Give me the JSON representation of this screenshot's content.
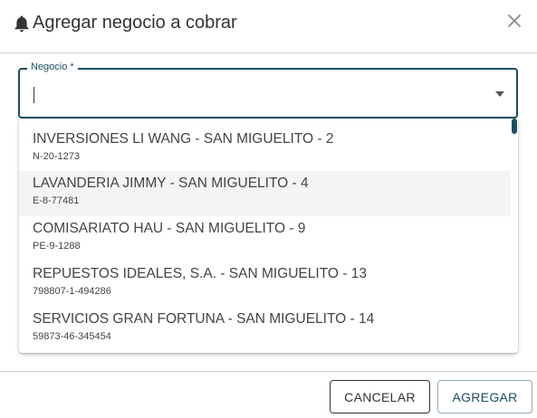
{
  "dialog": {
    "title": "Agregar negocio a cobrar",
    "icon": "bell-icon",
    "close_icon": "close-icon"
  },
  "field": {
    "label": "Negocio *",
    "value": "",
    "dropdown_icon": "caret-down-icon"
  },
  "options": [
    {
      "name": "INVERSIONES LI WANG - SAN MIGUELITO - 2",
      "code": "N-20-1273"
    },
    {
      "name": "LAVANDERIA JIMMY - SAN MIGUELITO - 4",
      "code": "E-8-77481"
    },
    {
      "name": "COMISARIATO HAU - SAN MIGUELITO - 9",
      "code": "PE-9-1288"
    },
    {
      "name": "REPUESTOS IDEALES, S.A. - SAN MIGUELITO - 13",
      "code": "798807-1-494286"
    },
    {
      "name": "SERVICIOS GRAN FORTUNA - SAN MIGUELITO - 14",
      "code": "59873-46-345454"
    }
  ],
  "footer": {
    "cancel_label": "CANCELAR",
    "add_label": "AGREGAR"
  },
  "colors": {
    "accent": "#1b4e63",
    "hover_row": "#f4f4f4",
    "divider": "#d6d6d6"
  }
}
